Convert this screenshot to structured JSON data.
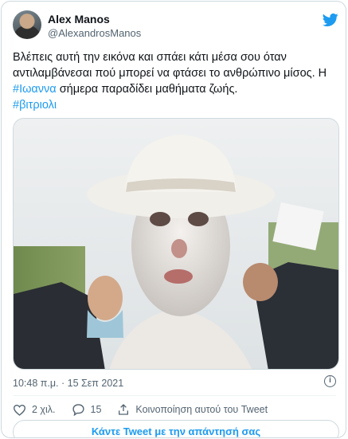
{
  "author": {
    "name": "Alex Manos",
    "handle": "@AlexandrosManos"
  },
  "tweet": {
    "text_part1": "Βλέπεις αυτή την εικόνα και σπάει κάτι μέσα σου όταν αντιλαμβάνεσαι πού μπορεί να φτάσει το ανθρώπινο μίσος. Η ",
    "hashtag1": "#Ιωαννα",
    "text_part2": " σήμερα παραδίδει μαθήματα ζωής.",
    "hashtag2": "#βιτριολι",
    "timestamp": "10:48 π.μ. · 15 Σεπ 2021"
  },
  "actions": {
    "likes": "2 χιλ.",
    "replies": "15",
    "share_label": "Κοινοποίηση αυτού του Tweet"
  },
  "reply_button": "Κάντε Tweet με την απάντησή σας",
  "icons": {
    "brand": "twitter-bird-icon",
    "info": "info-icon",
    "like": "heart-icon",
    "reply": "reply-bubble-icon",
    "share": "share-icon"
  },
  "colors": {
    "accent": "#1d9bf0",
    "text": "#0f1419",
    "secondary": "#536471",
    "border": "#cfd9de"
  }
}
